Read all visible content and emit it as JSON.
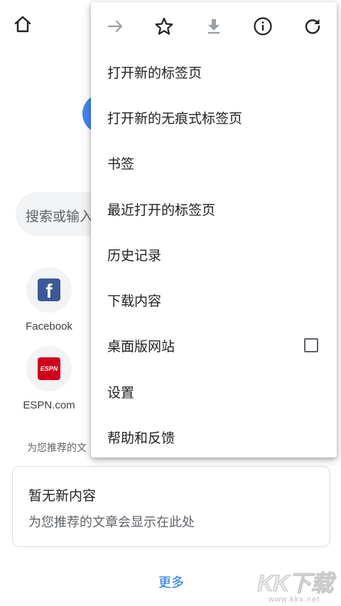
{
  "page": {
    "search_placeholder": "搜索或输入",
    "tiles": [
      {
        "label": "Facebook",
        "logo_text": "f",
        "color": "#3b5998"
      },
      {
        "label": "ESPN.com",
        "logo_text": "ESPN",
        "color": "#d0021b"
      }
    ],
    "section_label": "为您推荐的文",
    "card": {
      "title": "暂无新内容",
      "subtitle": "为您推荐的文章会显示在此处"
    },
    "more_link": "更多"
  },
  "menu": {
    "toolbar_icons": [
      "forward-icon",
      "star-icon",
      "download-icon",
      "info-icon",
      "reload-icon"
    ],
    "items": [
      {
        "label": "打开新的标签页"
      },
      {
        "label": "打开新的无痕式标签页"
      },
      {
        "label": "书签"
      },
      {
        "label": "最近打开的标签页"
      },
      {
        "label": "历史记录"
      },
      {
        "label": "下载内容"
      },
      {
        "label": "桌面版网站",
        "checkbox": false
      },
      {
        "label": "设置"
      },
      {
        "label": "帮助和反馈"
      }
    ]
  },
  "watermark": {
    "big": "KK下载",
    "small": "www.kkx.net"
  },
  "colors": {
    "accent": "#1a73e8",
    "google_blue": "#4285f4",
    "icon": "#202124",
    "disabled_icon": "#9aa0a6"
  }
}
